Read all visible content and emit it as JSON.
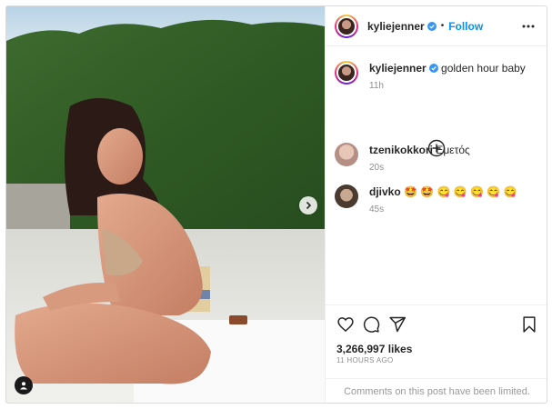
{
  "post": {
    "author": "kyliejenner",
    "follow_label": "Follow",
    "separator": "•",
    "more_icon": "more-horizontal-icon",
    "caption_text": "golden hour baby",
    "caption_time": "11h",
    "likes": "3,266,997 likes",
    "posted_ago": "11 HOURS AGO",
    "comments_limited": "Comments on this post have been limited."
  },
  "comments": [
    {
      "user": "tzenikokkori",
      "text": "Εμετός",
      "time": "20s"
    },
    {
      "user": "djivko",
      "text": "🤩 🤩 😋 😋 😋 😋 😋",
      "time": "45s"
    }
  ],
  "colors": {
    "link_blue": "#0095f6",
    "verified_blue": "#3897f0",
    "muted_text": "#8e8e8e",
    "border": "#dbdbdb"
  },
  "icons": {
    "media_next": "chevron-right-icon",
    "media_tag": "user-tag-icon",
    "load_more": "plus-circle-icon",
    "like": "heart-icon",
    "comment": "comment-bubble-icon",
    "share": "paper-plane-icon",
    "save": "bookmark-icon"
  }
}
